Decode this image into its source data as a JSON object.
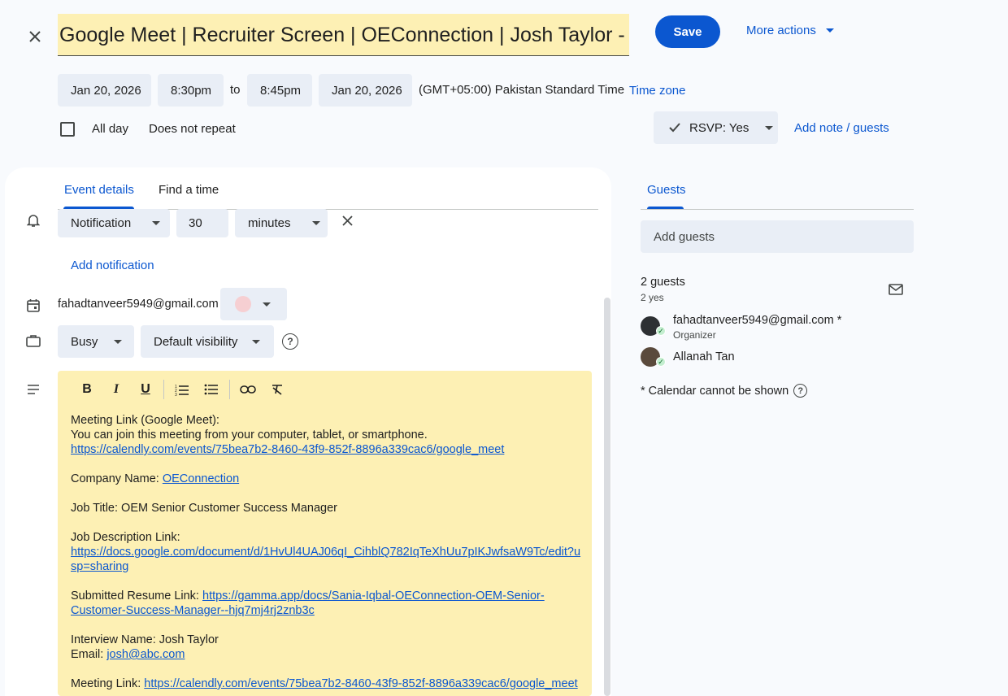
{
  "header": {
    "title": "Google Meet | Recruiter Screen | OEConnection | Josh Taylor - Dir",
    "save_label": "Save",
    "more_actions_label": "More actions"
  },
  "datetime": {
    "start_date": "Jan 20, 2026",
    "start_time": "8:30pm",
    "to_label": "to",
    "end_time": "8:45pm",
    "end_date": "Jan 20, 2026",
    "timezone_text": "(GMT+05:00) Pakistan Standard Time",
    "timezone_link": "Time zone",
    "all_day_label": "All day",
    "repeat_label": "Does not repeat",
    "rsvp_label": "RSVP: Yes",
    "add_note_label": "Add note / guests"
  },
  "tabs": {
    "event_details": "Event details",
    "find_time": "Find a time",
    "guests": "Guests"
  },
  "notification": {
    "type": "Notification",
    "amount": "30",
    "unit": "minutes",
    "add_label": "Add notification"
  },
  "calendar": {
    "owner_email": "fahadtanveer5949@gmail.com",
    "color": "#f6cfd2"
  },
  "availability": {
    "busy_label": "Busy",
    "visibility_label": "Default visibility"
  },
  "description": {
    "line1": "Meeting Link (Google Meet):",
    "line2": "You can join this meeting from your computer, tablet, or smartphone.",
    "link1": "https://calendly.com/events/75bea7b2-8460-43f9-852f-8896a339cac6/google_meet",
    "company_prefix": "Company Name: ",
    "company_link": "OEConnection",
    "job_title": "Job Title: OEM Senior Customer Success Manager",
    "job_desc_label": "Job Description Link:",
    "job_desc_link": "https://docs.google.com/document/d/1HvUl4UAJ06qI_CihblQ782IqTeXhUu7pIKJwfsaW9Tc/edit?usp=sharing",
    "resume_prefix": "Submitted Resume Link: ",
    "resume_link": "https://gamma.app/docs/Sania-Iqbal-OEConnection-OEM-Senior-Customer-Success-Manager--hjq7mj4rj2znb3c",
    "interview_name": "Interview Name: Josh Taylor",
    "email_prefix": "Email: ",
    "email_link": "josh@abc.com",
    "meeting_prefix": "Meeting Link: ",
    "meeting_link": "https://calendly.com/events/75bea7b2-8460-43f9-852f-8896a339cac6/google_meet"
  },
  "guests": {
    "add_placeholder": "Add guests",
    "count_label": "2 guests",
    "yes_label": "2 yes",
    "list": [
      {
        "name": "fahadtanveer5949@gmail.com *",
        "role": "Organizer"
      },
      {
        "name": "Allanah Tan",
        "role": ""
      }
    ],
    "calendar_note": "* Calendar cannot be shown"
  },
  "colors": {
    "accent": "#0b57d0",
    "description_bg": "#fdf0b4"
  }
}
